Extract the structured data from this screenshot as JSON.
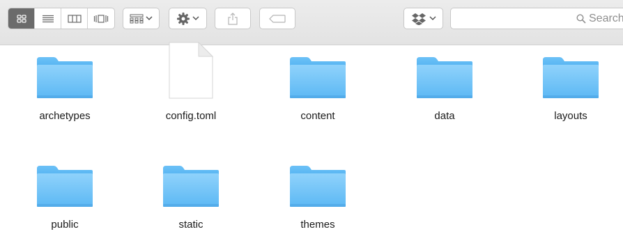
{
  "toolbar": {
    "view_modes": [
      {
        "name": "icon-view",
        "icon": "grid-icon",
        "active": true
      },
      {
        "name": "list-view",
        "icon": "list-icon",
        "active": false
      },
      {
        "name": "column-view",
        "icon": "columns-icon",
        "active": false
      },
      {
        "name": "coverflow-view",
        "icon": "coverflow-icon",
        "active": false
      }
    ],
    "arrange_icon": "arrange-grid-icon",
    "action_icon": "gear-icon",
    "share_icon": "share-icon",
    "tags_icon": "tag-icon",
    "dropbox_icon": "dropbox-icon",
    "search_placeholder": "Search"
  },
  "colors": {
    "folder_top": "#8fd2fb",
    "folder_bottom": "#5cb8f4",
    "active_segment": "#6b6b6b"
  },
  "items": [
    {
      "label": "archetypes",
      "kind": "folder"
    },
    {
      "label": "config.toml",
      "kind": "file"
    },
    {
      "label": "content",
      "kind": "folder"
    },
    {
      "label": "data",
      "kind": "folder"
    },
    {
      "label": "layouts",
      "kind": "folder"
    },
    {
      "label": "public",
      "kind": "folder"
    },
    {
      "label": "static",
      "kind": "folder"
    },
    {
      "label": "themes",
      "kind": "folder"
    }
  ]
}
